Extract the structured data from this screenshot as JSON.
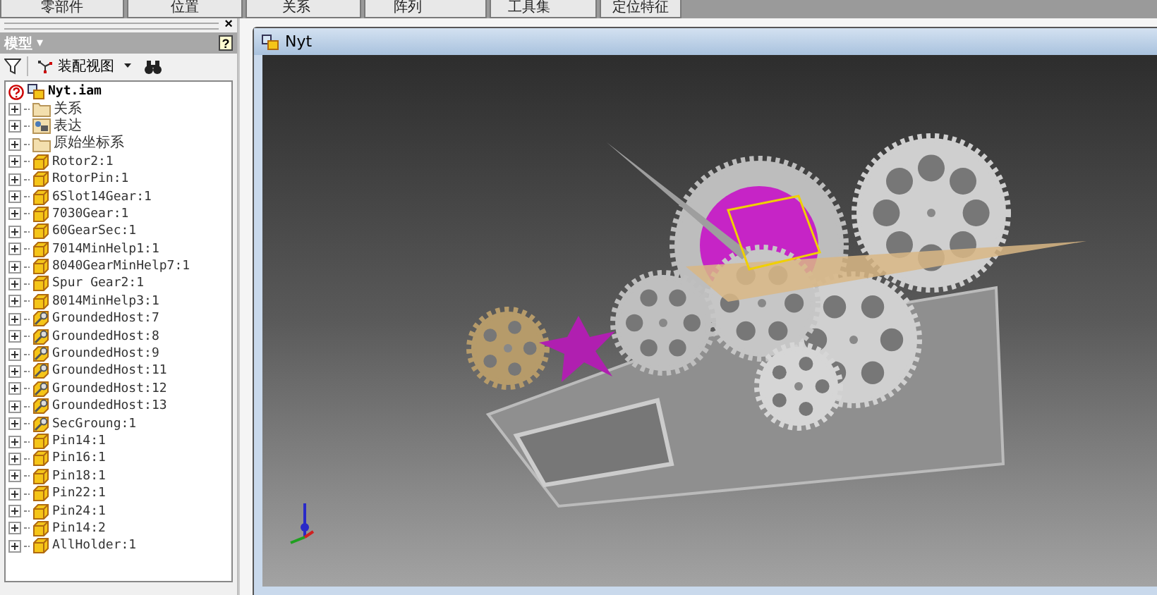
{
  "top_tabs": [
    {
      "label": "零部件"
    },
    {
      "label": "位置"
    },
    {
      "label": "关系"
    },
    {
      "label": "阵列"
    },
    {
      "label": "工具集"
    },
    {
      "label": "定位特征"
    }
  ],
  "browser": {
    "title": "模型",
    "title_caret": "▾",
    "help": "?",
    "close": "×",
    "toolbar": {
      "view": "装配视图"
    },
    "tree": {
      "label": "Nyt.iam",
      "children": [
        {
          "kind": "folder",
          "label": "关系",
          "expanded": false
        },
        {
          "kind": "representation",
          "label": "表达",
          "expanded": false
        },
        {
          "kind": "folder",
          "label": "原始坐标系",
          "expanded": false
        },
        {
          "kind": "part",
          "label": "Rotor2:1",
          "expanded": false
        },
        {
          "kind": "part",
          "label": "RotorPin:1",
          "expanded": false
        },
        {
          "kind": "part",
          "label": "6Slot14Gear:1",
          "expanded": false
        },
        {
          "kind": "part",
          "label": "7030Gear:1",
          "expanded": false
        },
        {
          "kind": "part",
          "label": "60GearSec:1",
          "expanded": false
        },
        {
          "kind": "part",
          "label": "7014MinHelp1:1",
          "expanded": false
        },
        {
          "kind": "part",
          "label": "8040GearMinHelp7:1",
          "expanded": false
        },
        {
          "kind": "part",
          "label": "Spur Gear2:1",
          "expanded": false
        },
        {
          "kind": "part",
          "label": "8014MinHelp3:1",
          "expanded": false
        },
        {
          "kind": "grounded",
          "label": "GroundedHost:7",
          "expanded": false
        },
        {
          "kind": "grounded",
          "label": "GroundedHost:8",
          "expanded": false
        },
        {
          "kind": "grounded",
          "label": "GroundedHost:9",
          "expanded": false
        },
        {
          "kind": "grounded",
          "label": "GroundedHost:11",
          "expanded": false
        },
        {
          "kind": "grounded",
          "label": "GroundedHost:12",
          "expanded": false
        },
        {
          "kind": "grounded",
          "label": "GroundedHost:13",
          "expanded": false
        },
        {
          "kind": "grounded",
          "label": "SecGroung:1",
          "expanded": false
        },
        {
          "kind": "part",
          "label": "Pin14:1",
          "expanded": false
        },
        {
          "kind": "part",
          "label": "Pin16:1",
          "expanded": false
        },
        {
          "kind": "part",
          "label": "Pin18:1",
          "expanded": false
        },
        {
          "kind": "part",
          "label": "Pin22:1",
          "expanded": false
        },
        {
          "kind": "part",
          "label": "Pin24:1",
          "expanded": false
        },
        {
          "kind": "part",
          "label": "Pin14:2",
          "expanded": false
        },
        {
          "kind": "part",
          "label": "AllHolder:1",
          "expanded": false
        }
      ]
    }
  },
  "document": {
    "title": "Nyt"
  }
}
